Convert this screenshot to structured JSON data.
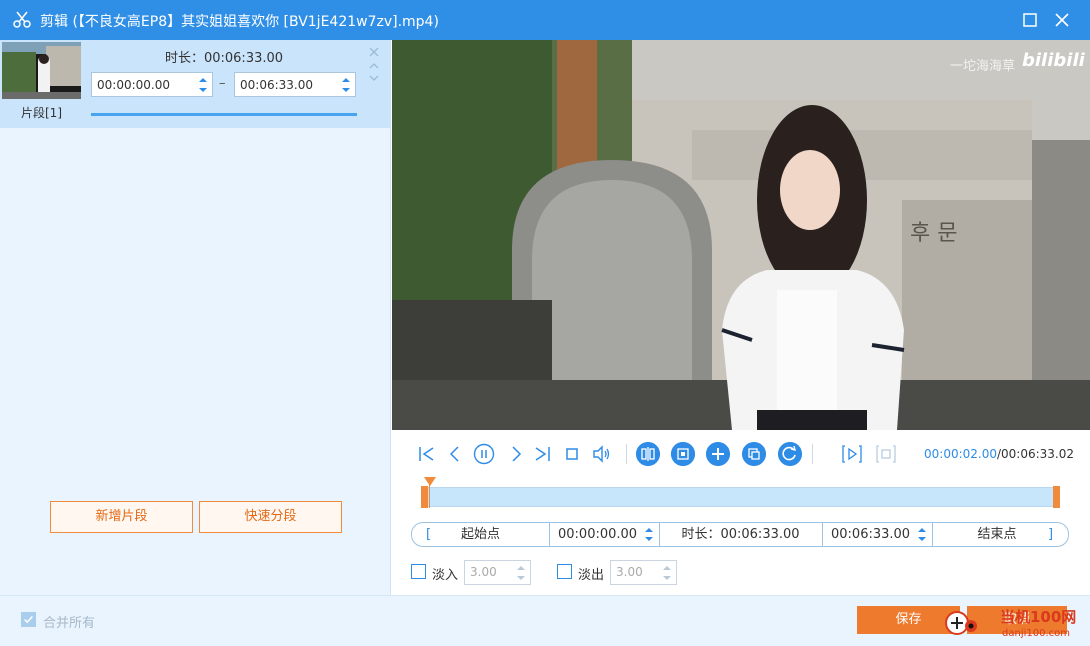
{
  "window": {
    "title": "剪辑 (【不良女高EP8】其实姐姐喜欢你 [BV1jE421w7zv].mp4)",
    "maximize_icon": "maximize-icon",
    "close_icon": "close-icon"
  },
  "segments": [
    {
      "label": "片段[1]",
      "duration": "时长：00:06:33.00",
      "start": "00:00:00.00",
      "end": "00:06:33.00",
      "separator": "–"
    }
  ],
  "left_actions": {
    "add_segment": "新增片段",
    "quick_split": "快速分段"
  },
  "video": {
    "watermark_text": "一坨海海草",
    "watermark_logo": "bilibili"
  },
  "playback": {
    "current_time": "00:00:02.00",
    "total_time": "/00:06:33.02",
    "progress": 0.005
  },
  "range": {
    "start_label": "起始点",
    "start_time": "00:00:00.00",
    "duration": "时长：00:06:33.00",
    "end_time": "00:06:33.00",
    "end_label": "结束点",
    "left_bracket": "[",
    "right_bracket": "]"
  },
  "fade": {
    "fade_in_label": "淡入",
    "fade_in_value": "3.00",
    "fade_out_label": "淡出",
    "fade_out_value": "3.00"
  },
  "footer": {
    "merge_all": "合并所有",
    "save": "保存",
    "cancel": "取消",
    "site_name": "当机100网",
    "site_url": "danji100.com"
  },
  "colors": {
    "titlebar": "#2f8fe6",
    "accent_orange": "#ee7a2e",
    "accent_blue": "#2e8ce6"
  }
}
